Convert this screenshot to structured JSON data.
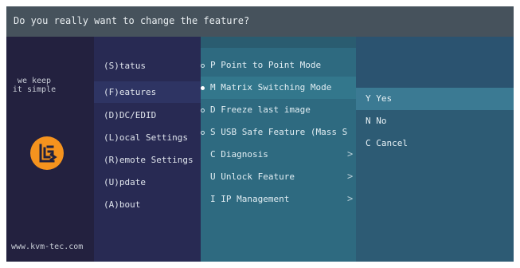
{
  "dialog": {
    "title": "Do you really want to change the feature?"
  },
  "sidebar": {
    "motto_line1": "we keep",
    "motto_line2": "it simple",
    "url": "www.kvm-tec.com"
  },
  "main_menu": {
    "items": [
      {
        "label": "(S)tatus"
      },
      {
        "label": "(F)eatures"
      },
      {
        "label": "(D)DC/EDID"
      },
      {
        "label": "(L)ocal Settings"
      },
      {
        "label": "(R)emote Settings"
      },
      {
        "label": "(U)pdate"
      },
      {
        "label": "(A)bout"
      }
    ],
    "selected": "(F)eatures"
  },
  "features_menu": {
    "items": [
      {
        "label": "P Point to Point Mode",
        "bullet": "empty",
        "chevron": ""
      },
      {
        "label": "M Matrix Switching Mode",
        "bullet": "filled",
        "chevron": ""
      },
      {
        "label": "D Freeze last image",
        "bullet": "empty",
        "chevron": ""
      },
      {
        "label": "S USB Safe Feature (Mass S",
        "bullet": "empty",
        "chevron": ""
      },
      {
        "label": "C Diagnosis",
        "bullet": "",
        "chevron": ">"
      },
      {
        "label": "U Unlock Feature",
        "bullet": "",
        "chevron": ">"
      },
      {
        "label": "I IP Management",
        "bullet": "",
        "chevron": ">"
      }
    ]
  },
  "confirm_menu": {
    "items": [
      {
        "label": "Y Yes"
      },
      {
        "label": "N No"
      },
      {
        "label": "C Cancel"
      }
    ],
    "selected": "Y Yes"
  },
  "colors": {
    "logo": "#f5931e",
    "title_bar": "#46525c",
    "features_panel": "#2e6a80",
    "confirm_panel": "#2d5b74"
  }
}
